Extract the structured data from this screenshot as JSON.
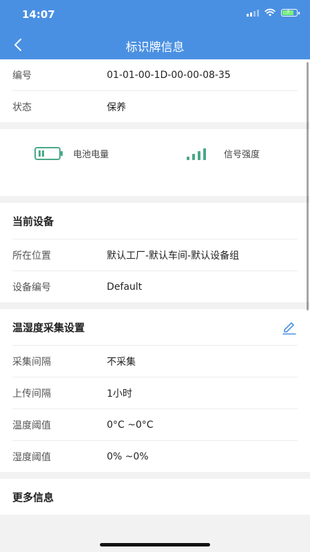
{
  "status": {
    "time": "14:07"
  },
  "header": {
    "title": "标识牌信息"
  },
  "basic": [
    {
      "label": "编号",
      "value": "01-01-00-1D-00-00-08-35"
    },
    {
      "label": "状态",
      "value": "保养"
    }
  ],
  "indicators": {
    "battery_label": "电池电量",
    "signal_label": "信号强度",
    "accent": "#4aa888"
  },
  "device": {
    "title": "当前设备",
    "rows": [
      {
        "label": "所在位置",
        "value": "默认工厂-默认车间-默认设备组"
      },
      {
        "label": "设备编号",
        "value": "Default"
      }
    ]
  },
  "collection": {
    "title": "温湿度采集设置",
    "rows": [
      {
        "label": "采集间隔",
        "value": "不采集"
      },
      {
        "label": "上传间隔",
        "value": "1小时"
      },
      {
        "label": "温度阈值",
        "value": "0°C ~0°C"
      },
      {
        "label": "湿度阈值",
        "value": "0% ~0%"
      }
    ]
  },
  "more": {
    "title": "更多信息"
  },
  "colors": {
    "primary": "#4a90e2",
    "edit": "#4a90e2"
  }
}
